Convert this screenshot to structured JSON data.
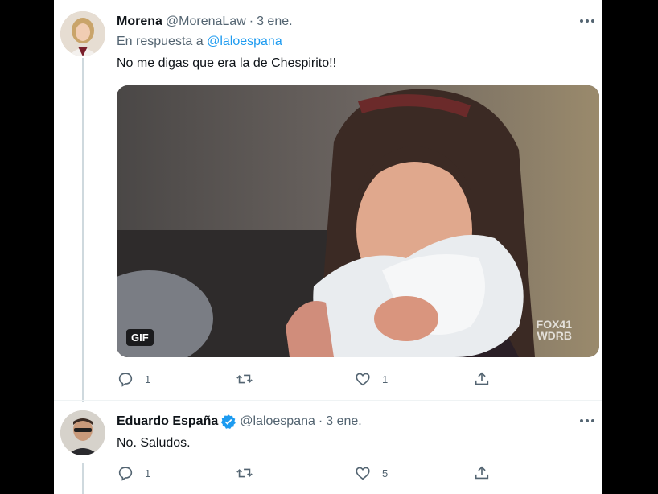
{
  "tweets": [
    {
      "name": "Morena",
      "handle": "@MorenaLaw",
      "dot": "·",
      "date": "3 ene.",
      "reply_prefix": "En respuesta a",
      "reply_handle": "@laloespana",
      "text": "No me digas que era la de Chespirito!!",
      "media": {
        "gif_label": "GIF",
        "watermark_line1": "FOX41",
        "watermark_line2": "WDRB"
      },
      "actions": {
        "replies": "1",
        "retweets": "",
        "likes": "1"
      }
    },
    {
      "name": "Eduardo España",
      "verified": true,
      "handle": "@laloespana",
      "dot": "·",
      "date": "3 ene.",
      "text": "No. Saludos.",
      "actions": {
        "replies": "1",
        "retweets": "",
        "likes": "5"
      }
    }
  ],
  "icons": {
    "more": "more-dots-icon",
    "reply": "reply-bubble-icon",
    "retweet": "retweet-icon",
    "like": "heart-icon",
    "share": "share-icon",
    "verified": "verified-badge-icon"
  },
  "colors": {
    "accent": "#1d9bf0",
    "secondary_text": "#536471",
    "primary_text": "#0f1419"
  }
}
